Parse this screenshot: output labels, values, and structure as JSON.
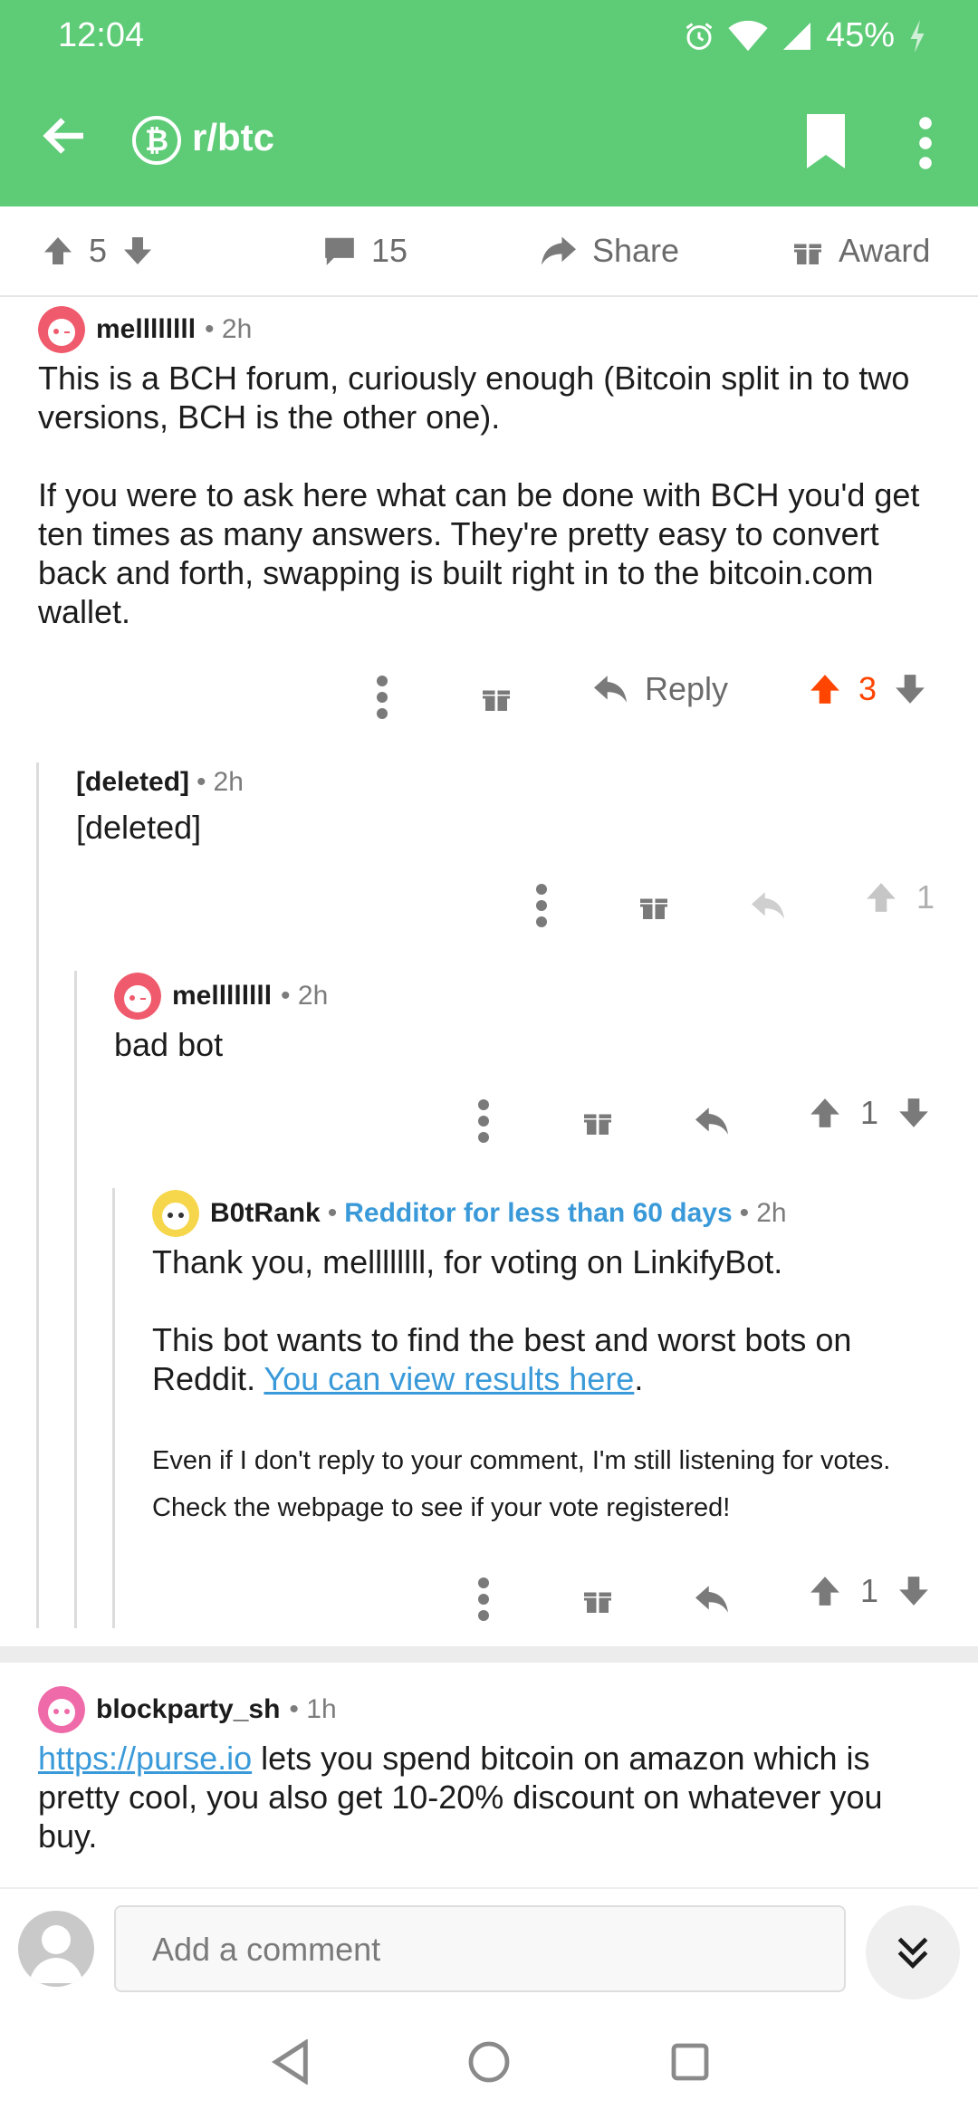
{
  "status": {
    "time": "12:04",
    "battery": "45%"
  },
  "header": {
    "subreddit": "r/btc",
    "sub_icon_glyph": "₿"
  },
  "post_actions": {
    "score": "5",
    "comments": "15",
    "share": "Share",
    "award": "Award"
  },
  "comments": [
    {
      "author": "mellllllll",
      "age": "• 2h",
      "paragraphs": [
        "This is a BCH forum, curiously enough (Bitcoin split in to two versions, BCH is the other one).",
        "If you were to ask here what can be done with BCH you'd get ten times as many answers. They're pretty easy to convert back and forth, swapping is built right in to the bitcoin.com wallet."
      ],
      "reply_label": "Reply",
      "score": "3"
    },
    {
      "author": "[deleted]",
      "age": "2h",
      "body": "[deleted]",
      "score": "1"
    },
    {
      "author": "mellllllll",
      "age": "• 2h",
      "body": "bad bot",
      "score": "1"
    },
    {
      "author": "B0tRank",
      "flair": "Redditor for less than 60 days",
      "age": "2h",
      "p1": "Thank you, mellllllll, for voting on LinkifyBot.",
      "p2_pre": "This bot wants to find the best and worst bots on Reddit. ",
      "p2_link": "You can view results here",
      "p2_post": ".",
      "p3_line1": "Even if I don't reply to your comment, I'm still listening for votes.",
      "p3_line2": "Check the webpage to see if your vote registered!",
      "score": "1"
    },
    {
      "author": "blockparty_sh",
      "age": "• 1h",
      "link": "https://purse.io",
      "body": " lets you spend bitcoin on amazon which is pretty cool, you also get 10-20% discount on whatever you buy."
    }
  ],
  "composer": {
    "placeholder": "Add a comment"
  },
  "colors": {
    "brand_green": "#5ecb77",
    "upvote_orange": "#ff4500",
    "link_blue": "#3a9ad9"
  }
}
